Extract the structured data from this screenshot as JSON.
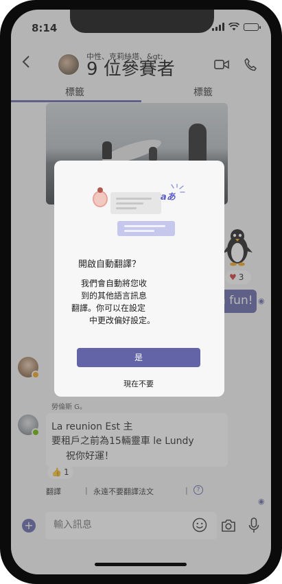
{
  "status_bar": {
    "time": "8:14"
  },
  "header": {
    "subtitle": "中性、克莉絲塔、&gt;",
    "title": "9 位參賽者"
  },
  "tabs": [
    {
      "label": "標籤",
      "active": true
    },
    {
      "label": "標籤",
      "active": false
    }
  ],
  "chat": {
    "heart_reaction": {
      "emoji": "♥",
      "count": "3"
    },
    "my_message_preview": "n fun!",
    "sender_name": "勞倫斯 G。",
    "message_lines": [
      "La reunion Est 主",
      "要租戶之前為15輛靈車 le Lundy",
      "祝你好運！"
    ],
    "thumb_reaction": {
      "emoji": "👍",
      "count": "1"
    },
    "translate_link": "翻譯",
    "never_translate_link": "永遠不要翻譯法文",
    "help_label": "?"
  },
  "composer": {
    "placeholder": "輸入訊息"
  },
  "dialog": {
    "illustration_text": "aあ",
    "title": "開啟自動翻譯？",
    "body_lines": [
      "我們會自動將您收",
      "到的其他語言訊息",
      "翻譯。你可以在設定",
      "中更改偏好設定。"
    ],
    "primary_button": "是",
    "secondary_button": "現在不要"
  },
  "colors": {
    "accent": "#6264a7",
    "away_status": "#f0a21d",
    "available_status": "#6bb700"
  },
  "icons": {
    "back": "chevron-left-icon",
    "video": "video-icon",
    "call": "phone-icon",
    "add": "plus-icon",
    "emoji": "emoji-icon",
    "camera": "camera-icon",
    "mic": "mic-icon",
    "seen": "eye-icon",
    "help": "help-icon"
  }
}
